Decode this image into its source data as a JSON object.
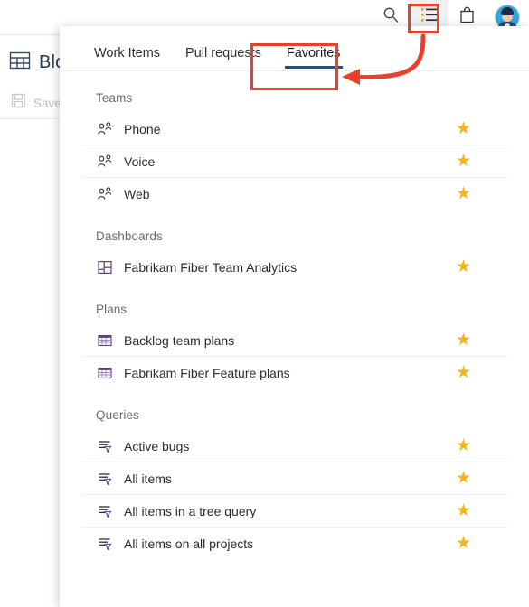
{
  "background": {
    "title": "Bloc",
    "title_icon": "board-grid-icon",
    "command_label": "Save",
    "command_icon": "save-floppy-icon"
  },
  "topbar": {
    "actions": [
      {
        "name": "search-icon",
        "label": "Search"
      },
      {
        "name": "favorites-list-icon",
        "label": "Favorites"
      },
      {
        "name": "shopping-bag-icon",
        "label": "Marketplace"
      },
      {
        "name": "avatar",
        "label": "User settings"
      }
    ]
  },
  "panel": {
    "tabs": [
      {
        "label": "Work Items",
        "active": false
      },
      {
        "label": "Pull requests",
        "active": false
      },
      {
        "label": "Favorites",
        "active": true
      }
    ],
    "sections": [
      {
        "title": "Teams",
        "icon": "team-people-icon",
        "items": [
          {
            "label": "Phone",
            "star": "★"
          },
          {
            "label": "Voice",
            "star": "★"
          },
          {
            "label": "Web",
            "star": "★"
          }
        ]
      },
      {
        "title": "Dashboards",
        "icon": "dashboard-grid-icon",
        "items": [
          {
            "label": "Fabrikam Fiber Team Analytics",
            "star": "★"
          }
        ]
      },
      {
        "title": "Plans",
        "icon": "plan-table-icon",
        "items": [
          {
            "label": "Backlog team plans",
            "star": "★"
          },
          {
            "label": "Fabrikam Fiber Feature plans",
            "star": "★"
          }
        ]
      },
      {
        "title": "Queries",
        "icon": "query-filter-icon",
        "items": [
          {
            "label": "Active bugs",
            "star": "★"
          },
          {
            "label": "All items",
            "star": "★"
          },
          {
            "label": "All items in a tree query",
            "star": "★"
          },
          {
            "label": "All items on all projects",
            "star": "★"
          }
        ]
      }
    ]
  },
  "colors": {
    "accent_blue": "#0a5c9e",
    "star_gold": "#f5b316",
    "callout_red": "#e8402a"
  }
}
